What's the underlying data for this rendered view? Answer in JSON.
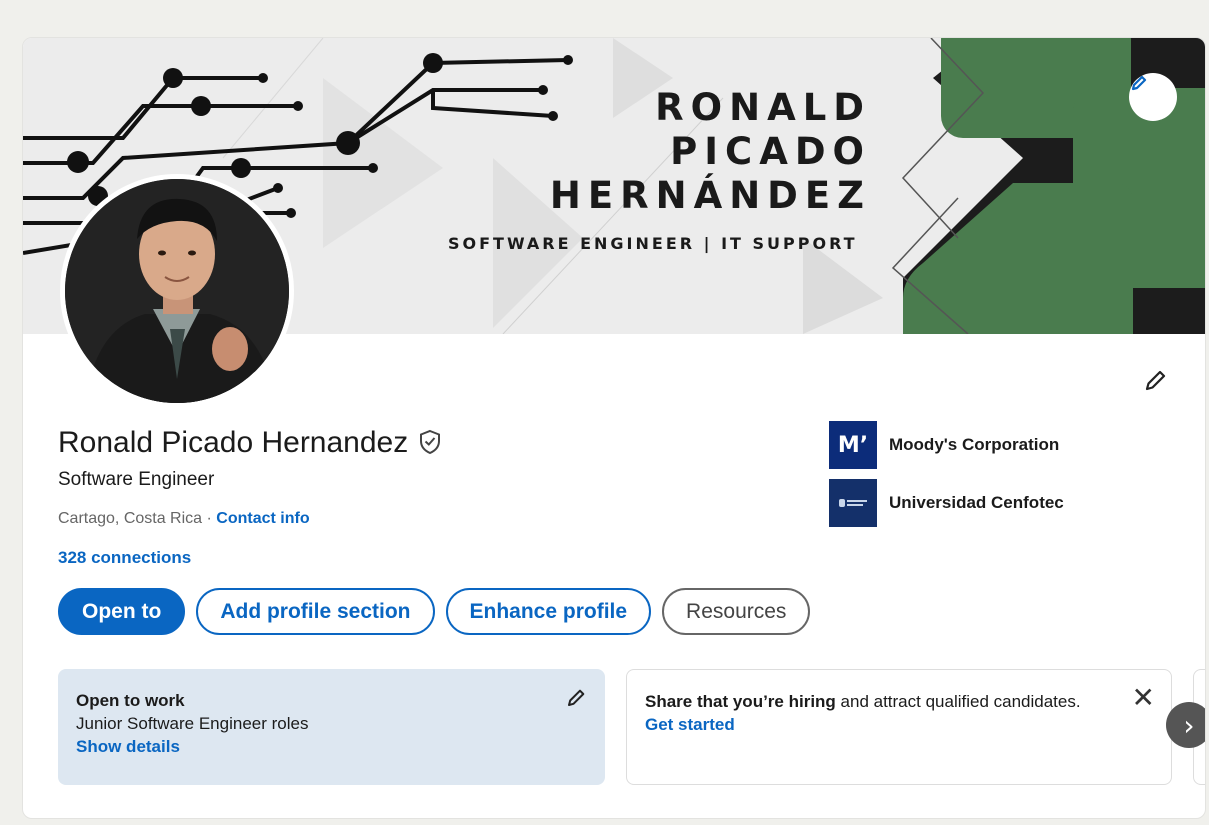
{
  "banner": {
    "name_lines": [
      "RONALD",
      "PICADO",
      "HERNÁNDEZ"
    ],
    "tagline": "SOFTWARE ENGINEER | IT SUPPORT",
    "accent_color": "#4a7c4e"
  },
  "profile": {
    "name": "Ronald Picado Hernandez",
    "headline": "Software Engineer",
    "location": "Cartago, Costa Rica",
    "separator": " · ",
    "contact_link": "Contact info",
    "connections": "328 connections"
  },
  "organizations": [
    {
      "name": "Moody's Corporation",
      "logo_text": "M’"
    },
    {
      "name": "Universidad Cenfotec",
      "logo_text": ""
    }
  ],
  "actions": {
    "open_to": "Open to",
    "add_section": "Add profile section",
    "enhance": "Enhance profile",
    "resources": "Resources"
  },
  "open_to_work": {
    "title": "Open to work",
    "roles": "Junior Software Engineer roles",
    "link": "Show details"
  },
  "hiring": {
    "bold": "Share that you’re hiring",
    "rest": " and attract qualified candidates.",
    "link": "Get started"
  },
  "colors": {
    "brand_blue": "#0a66c2",
    "card_bg": "#dde7f1"
  }
}
